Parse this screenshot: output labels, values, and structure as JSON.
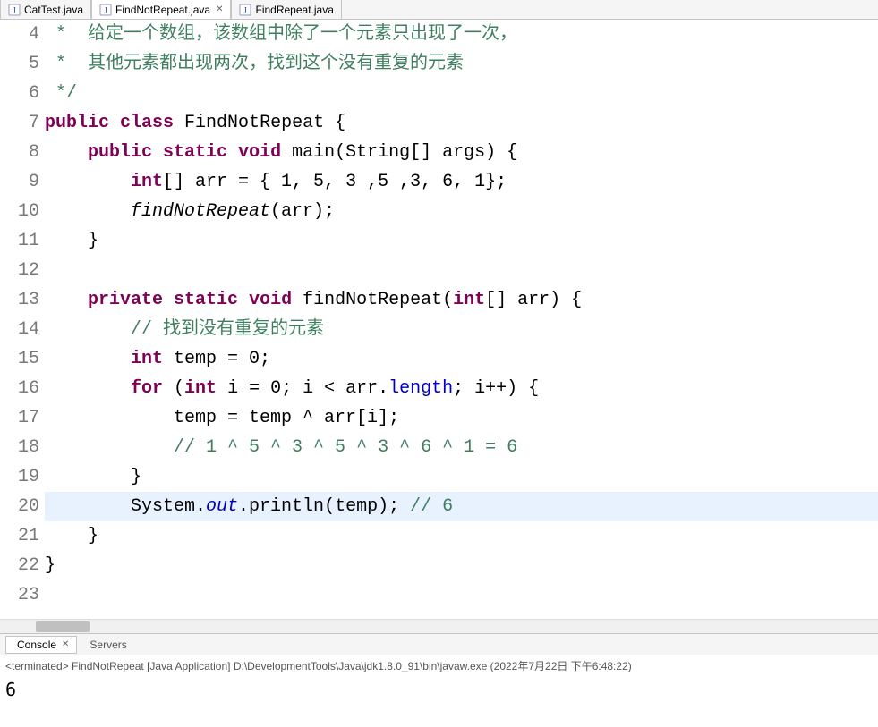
{
  "tabs": [
    {
      "label": "CatTest.java",
      "active": false,
      "closable": false
    },
    {
      "label": "FindNotRepeat.java",
      "active": true,
      "closable": true
    },
    {
      "label": "FindRepeat.java",
      "active": false,
      "closable": false
    }
  ],
  "code": {
    "lines": [
      {
        "n": 4,
        "marked": false,
        "hl": false,
        "tokens": [
          {
            "t": " *  ",
            "c": "com"
          },
          {
            "t": "给定一个数组，该数组中除了一个元素只出现了一次，",
            "c": "com"
          }
        ]
      },
      {
        "n": 5,
        "marked": false,
        "hl": false,
        "tokens": [
          {
            "t": " *  ",
            "c": "com"
          },
          {
            "t": "其他元素都出现两次，找到这个没有重复的元素",
            "c": "com"
          }
        ]
      },
      {
        "n": 6,
        "marked": false,
        "hl": false,
        "tokens": [
          {
            "t": " */",
            "c": "com"
          }
        ]
      },
      {
        "n": 7,
        "marked": false,
        "hl": false,
        "tokens": [
          {
            "t": "public",
            "c": "kw"
          },
          {
            "t": " "
          },
          {
            "t": "class",
            "c": "kw"
          },
          {
            "t": " FindNotRepeat {"
          }
        ]
      },
      {
        "n": 8,
        "marked": false,
        "hl": false,
        "tokens": [
          {
            "t": "    "
          },
          {
            "t": "public",
            "c": "kw"
          },
          {
            "t": " "
          },
          {
            "t": "static",
            "c": "kw"
          },
          {
            "t": " "
          },
          {
            "t": "void",
            "c": "kw"
          },
          {
            "t": " main(String[] args) {"
          }
        ]
      },
      {
        "n": 9,
        "marked": false,
        "hl": false,
        "tokens": [
          {
            "t": "        "
          },
          {
            "t": "int",
            "c": "kw"
          },
          {
            "t": "[] arr = { 1, 5, 3 ,5 ,3, 6, 1};"
          }
        ]
      },
      {
        "n": 10,
        "marked": false,
        "hl": false,
        "tokens": [
          {
            "t": "        "
          },
          {
            "t": "findNotRepeat",
            "c": "mtd"
          },
          {
            "t": "(arr);"
          }
        ]
      },
      {
        "n": 11,
        "marked": false,
        "hl": false,
        "tokens": [
          {
            "t": "    }"
          }
        ]
      },
      {
        "n": 12,
        "marked": false,
        "hl": false,
        "tokens": [
          {
            "t": ""
          }
        ]
      },
      {
        "n": 13,
        "marked": true,
        "hl": false,
        "tokens": [
          {
            "t": "    "
          },
          {
            "t": "private",
            "c": "kw"
          },
          {
            "t": " "
          },
          {
            "t": "static",
            "c": "kw"
          },
          {
            "t": " "
          },
          {
            "t": "void",
            "c": "kw"
          },
          {
            "t": " findNotRepeat("
          },
          {
            "t": "int",
            "c": "kw"
          },
          {
            "t": "[] arr) {"
          }
        ]
      },
      {
        "n": 14,
        "marked": true,
        "hl": false,
        "tokens": [
          {
            "t": "        "
          },
          {
            "t": "// 找到没有重复的元素",
            "c": "com"
          }
        ]
      },
      {
        "n": 15,
        "marked": true,
        "hl": false,
        "tokens": [
          {
            "t": "        "
          },
          {
            "t": "int",
            "c": "kw"
          },
          {
            "t": " temp = 0;"
          }
        ]
      },
      {
        "n": 16,
        "marked": true,
        "hl": false,
        "tokens": [
          {
            "t": "        "
          },
          {
            "t": "for",
            "c": "kw"
          },
          {
            "t": " ("
          },
          {
            "t": "int",
            "c": "kw"
          },
          {
            "t": " i = 0; i < arr."
          },
          {
            "t": "length",
            "c": "str"
          },
          {
            "t": "; i++) {"
          }
        ]
      },
      {
        "n": 17,
        "marked": true,
        "hl": false,
        "tokens": [
          {
            "t": "            temp = temp ^ arr[i];"
          }
        ]
      },
      {
        "n": 18,
        "marked": true,
        "hl": false,
        "tokens": [
          {
            "t": "            "
          },
          {
            "t": "// 1 ^ 5 ^ 3 ^ 5 ^ 3 ^ 6 ^ 1 = 6",
            "c": "com"
          }
        ]
      },
      {
        "n": 19,
        "marked": true,
        "hl": false,
        "tokens": [
          {
            "t": "        }"
          }
        ]
      },
      {
        "n": 20,
        "marked": true,
        "hl": true,
        "tokens": [
          {
            "t": "        System."
          },
          {
            "t": "out",
            "c": "fld"
          },
          {
            "t": ".println(temp); "
          },
          {
            "t": "// 6",
            "c": "com"
          }
        ]
      },
      {
        "n": 21,
        "marked": true,
        "hl": false,
        "tokens": [
          {
            "t": "    }"
          }
        ]
      },
      {
        "n": 22,
        "marked": false,
        "hl": false,
        "tokens": [
          {
            "t": "}"
          }
        ]
      },
      {
        "n": 23,
        "marked": false,
        "hl": false,
        "tokens": [
          {
            "t": ""
          }
        ]
      }
    ]
  },
  "bottom": {
    "console_label": "Console",
    "servers_label": "Servers",
    "terminated": "<terminated> FindNotRepeat [Java Application] D:\\DevelopmentTools\\Java\\jdk1.8.0_91\\bin\\javaw.exe (2022年7月22日 下午6:48:22)",
    "output": "6"
  }
}
